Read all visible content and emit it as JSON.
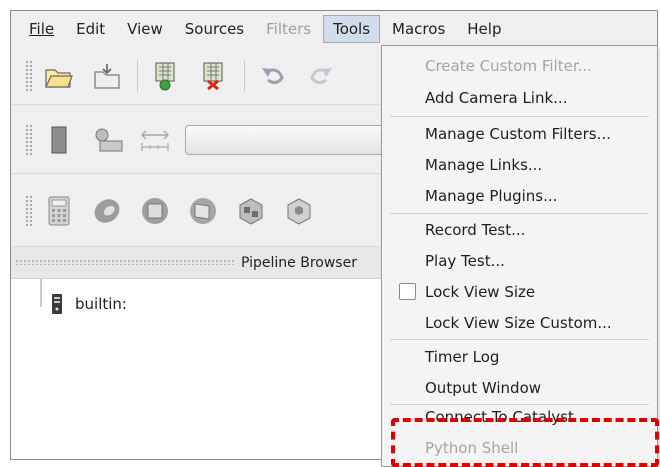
{
  "menubar": {
    "file": "File",
    "edit": "Edit",
    "view": "View",
    "sources": "Sources",
    "filters": "Filters",
    "tools": "Tools",
    "macros": "Macros",
    "help": "Help"
  },
  "pipeline": {
    "title": "Pipeline Browser",
    "root_label": "builtin:"
  },
  "tools_menu": {
    "create_custom_filter": "Create Custom Filter...",
    "add_camera_link": "Add Camera Link...",
    "manage_custom_filters": "Manage Custom Filters...",
    "manage_links": "Manage Links...",
    "manage_plugins": "Manage Plugins...",
    "record_test": "Record Test...",
    "play_test": "Play Test...",
    "lock_view_size": "Lock View Size",
    "lock_view_size_custom": "Lock View Size Custom...",
    "timer_log": "Timer Log",
    "output_window": "Output Window",
    "connect_to_catalyst": "Connect To Catalyst",
    "python_shell": "Python Shell"
  },
  "colors": {
    "highlight": "#e00000",
    "open_menu_bg": "#d2dcea"
  },
  "icons": [
    "open-folder-icon",
    "save-state-icon",
    "connect-icon",
    "disconnect-icon",
    "undo-icon",
    "redo-icon",
    "box-icon",
    "camera-link-icon",
    "calculator-icon",
    "contour-icon",
    "clip-icon",
    "slice-icon",
    "threshold-icon",
    "extract-icon",
    "server-icon"
  ]
}
